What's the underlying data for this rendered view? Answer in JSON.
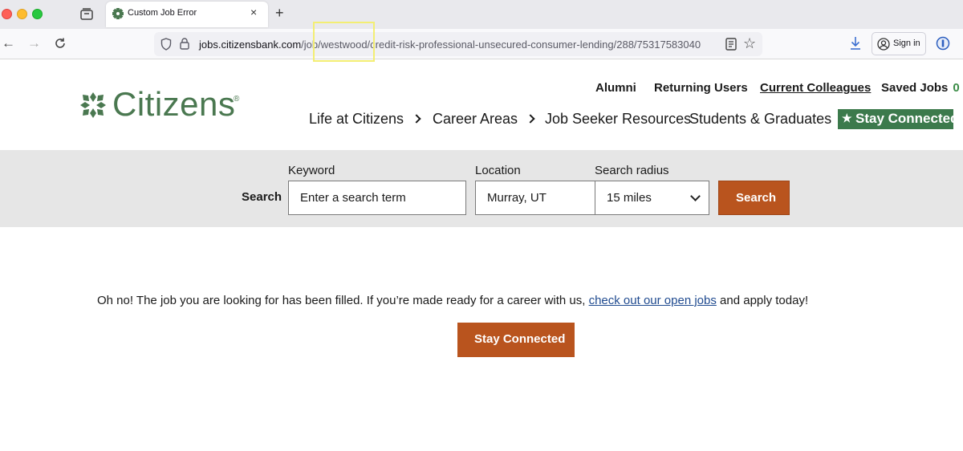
{
  "browser": {
    "tab_title": "Custom Job Error",
    "tab_close": "×",
    "new_tab": "+",
    "url_host": "jobs.citizensbank.com",
    "url_path": "/job/westwood/credit-risk-professional-unsecured-consumer-lending/288/75317583040",
    "sign_in": "Sign in"
  },
  "header": {
    "logo_text": "Citizens",
    "logo_reg": "®",
    "utility": {
      "alumni": "Alumni",
      "returning": "Returning Users",
      "colleagues": "Current Colleagues",
      "saved": "Saved Jobs",
      "saved_count": "0"
    },
    "nav": {
      "life": "Life at Citizens",
      "career": "Career Areas",
      "resources": "Job Seeker Resources",
      "students": "Students & Graduates",
      "stay_connected": "Stay Connected"
    }
  },
  "search": {
    "heading": "Search",
    "keyword_label": "Keyword",
    "keyword_placeholder": "Enter a search term",
    "location_label": "Location",
    "location_value": "Murray, UT",
    "radius_label": "Search radius",
    "radius_value": "15 miles",
    "button": "Search"
  },
  "content": {
    "message_before": "Oh no! The job you are looking for has been filled. If you’re made ready for a career with us,",
    "message_link": "check out our open jobs",
    "message_after": "and apply today!",
    "stay_button": "Stay Connected"
  },
  "colors": {
    "brand_green": "#4a7850",
    "accent_orange": "#b9541e",
    "link_blue": "#1f4a8f"
  },
  "icons": [
    "back-icon",
    "forward-icon",
    "reload-icon",
    "shield-icon",
    "lock-icon",
    "reader-icon",
    "star-icon",
    "download-icon",
    "account-icon",
    "extension-icon",
    "chevron-right-icon",
    "chevron-down-icon"
  ]
}
